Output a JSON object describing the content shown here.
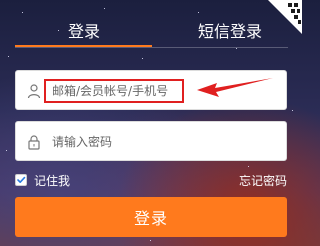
{
  "tabs": {
    "login": "登录",
    "sms_login": "短信登录"
  },
  "form": {
    "username_placeholder": "邮箱/会员帐号/手机号",
    "password_placeholder": "请输入密码",
    "remember_me": "记住我",
    "forgot_password": "忘记密码",
    "remember_checked": true,
    "submit_label": "登录"
  },
  "icons": {
    "qr_corner": "qr-code-icon",
    "username": "user-icon",
    "password": "lock-icon",
    "check": "check-icon"
  },
  "colors": {
    "accent": "#ff7a1d",
    "annotation": "#e02020",
    "field_bg": "#ffffff",
    "text_light": "#ffffff"
  }
}
